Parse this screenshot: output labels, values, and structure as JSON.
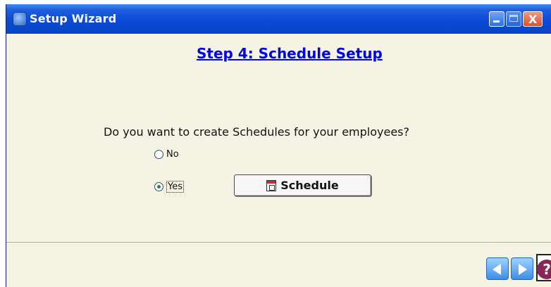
{
  "window": {
    "title": "Setup Wizard",
    "icon": "app-wizard-icon"
  },
  "content": {
    "step_title": "Step 4: Schedule Setup",
    "question": "Do you want to create Schedules for your employees?",
    "options": [
      {
        "label": "No",
        "selected": false
      },
      {
        "label": "Yes",
        "selected": true
      }
    ],
    "schedule_button": {
      "label": "Schedule",
      "icon": "calendar-icon"
    }
  },
  "footer": {
    "back_icon": "arrow-left-icon",
    "next_icon": "arrow-right-icon",
    "help_icon": "question-icon",
    "help_symbol": "?"
  },
  "colors": {
    "titlebar": "#0a4ad6",
    "step_title": "#0000e6",
    "background": "#f5f3e4",
    "help": "#8a2557"
  }
}
